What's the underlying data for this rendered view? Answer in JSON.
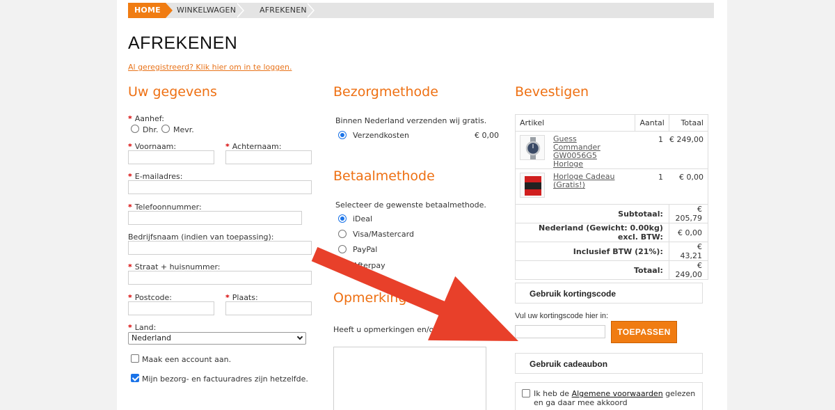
{
  "breadcrumbs": [
    "HOME",
    "WINKELWAGEN",
    "AFREKENEN"
  ],
  "page_title": "AFREKENEN",
  "login_link": "Al geregistreerd? Klik hier om in te loggen.",
  "required_marker": "*",
  "details": {
    "heading": "Uw gegevens",
    "salutation_label": "Aanhef:",
    "salutation_options": [
      "Dhr.",
      "Mevr."
    ],
    "firstname_label": "Voornaam:",
    "lastname_label": "Achternaam:",
    "email_label": "E-mailadres:",
    "phone_label": "Telefoonnummer:",
    "company_label": "Bedrijfsnaam (indien van toepassing):",
    "street_label": "Straat + huisnummer:",
    "postcode_label": "Postcode:",
    "city_label": "Plaats:",
    "country_label": "Land:",
    "country_value": "Nederland",
    "create_account_label": "Maak een account aan.",
    "same_address_label": "Mijn bezorg- en factuuradres zijn hetzelfde.",
    "same_address_checked": true
  },
  "shipping": {
    "heading": "Bezorgmethode",
    "note": "Binnen Nederland verzenden wij gratis.",
    "option_label": "Verzendkosten",
    "option_price": "€ 0,00"
  },
  "payment": {
    "heading": "Betaalmethode",
    "note": "Selecteer de gewenste betaalmethode.",
    "options": [
      "iDeal",
      "Visa/Mastercard",
      "PayPal",
      "Afterpay"
    ],
    "selected": "iDeal"
  },
  "remarks": {
    "heading": "Opmerkingen",
    "note": "Heeft u opmerkingen en/of vragen?"
  },
  "confirm": {
    "heading": "Bevestigen",
    "columns": [
      "Artikel",
      "Aantal",
      "Totaal"
    ],
    "items": [
      {
        "name": "Guess Commander GW0056G5 Horloge",
        "qty": "1",
        "total": "€ 249,00"
      },
      {
        "name": "Horloge Cadeau (Gratis!)",
        "qty": "1",
        "total": "€ 0,00"
      }
    ],
    "summary": [
      {
        "label": "Subtotaal:",
        "value": "€ 205,79"
      },
      {
        "label": "Nederland (Gewicht: 0.00kg) excl. BTW:",
        "value": "€ 0,00"
      },
      {
        "label": "Inclusief BTW (21%):",
        "value": "€ 43,21"
      },
      {
        "label": "Totaal:",
        "value": "€ 249,00"
      }
    ],
    "coupon_heading": "Gebruik kortingscode",
    "coupon_prompt": "Vul uw kortingscode hier in:",
    "apply_button": "TOEPASSEN",
    "voucher_heading": "Gebruik cadeaubon",
    "terms_prefix": "Ik heb de",
    "terms_link": "Algemene voorwaarden",
    "terms_suffix": "gelezen en ga daar mee akkoord"
  },
  "colors": {
    "accent": "#ee7013",
    "arrow": "#e8402a",
    "radio_selected": "#1a73e8"
  }
}
